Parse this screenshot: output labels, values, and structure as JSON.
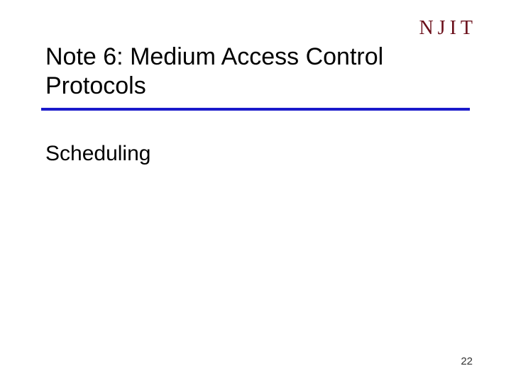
{
  "logo": {
    "text": "NJIT"
  },
  "title": "Note 6: Medium Access Control Protocols",
  "subtitle": "Scheduling",
  "page_number": "22",
  "colors": {
    "rule": "#1a1acb",
    "logo": "#6b0f1a"
  }
}
